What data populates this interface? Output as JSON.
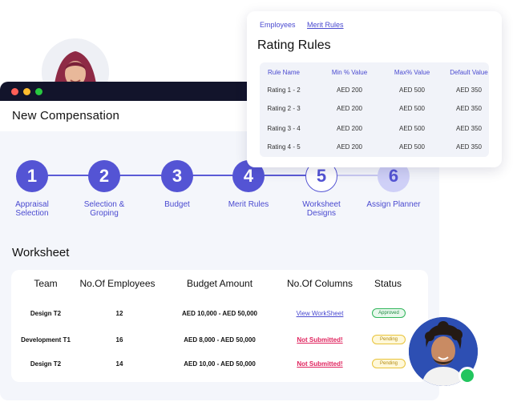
{
  "window": {
    "title": "New Compensation"
  },
  "stepper": {
    "steps": [
      {
        "number": "1",
        "label_line1": "Appraisal",
        "label_line2": "Selection",
        "state": "done"
      },
      {
        "number": "2",
        "label_line1": "Selection &",
        "label_line2": "Groping",
        "state": "done"
      },
      {
        "number": "3",
        "label_line1": "Budget",
        "label_line2": "",
        "state": "done"
      },
      {
        "number": "4",
        "label_line1": "Merit Rules",
        "label_line2": "",
        "state": "done"
      },
      {
        "number": "5",
        "label_line1": "Worksheet",
        "label_line2": "Designs",
        "state": "current"
      },
      {
        "number": "6",
        "label_line1": "Assign Planner",
        "label_line2": "",
        "state": "upcoming"
      }
    ]
  },
  "worksheet": {
    "title": "Worksheet",
    "headers": [
      "Team",
      "No.Of Employees",
      "Budget Amount",
      "No.Of Columns",
      "Status"
    ],
    "rows": [
      {
        "team": "Design T2",
        "employees": "12",
        "budget": "AED 10,000 - AED 50,000",
        "columns": "View WorkSheet",
        "status": "Approved"
      },
      {
        "team": "Development T1",
        "employees": "16",
        "budget": "AED 8,000 - AED 50,000",
        "columns": "Not Submitted!",
        "status": "Pending"
      },
      {
        "team": "Design T2",
        "employees": "14",
        "budget": "AED 10,00 - AED 50,000",
        "columns": "Not Submitted!",
        "status": "Pending"
      }
    ]
  },
  "rating_rules": {
    "tabs": [
      "Employees",
      "Merit Rules"
    ],
    "active_tab": "Merit Rules",
    "title": "Rating Rules",
    "headers": [
      "Rule Name",
      "Min % Value",
      "Max% Value",
      "Default Value"
    ],
    "rows": [
      [
        "Rating 1 - 2",
        "AED 200",
        "AED 500",
        "AED 350"
      ],
      [
        "Rating 2 - 3",
        "AED 200",
        "AED 500",
        "AED 350"
      ],
      [
        "Rating 3 - 4",
        "AED 200",
        "AED 500",
        "AED 350"
      ],
      [
        "Rating 4 - 5",
        "AED 200",
        "AED 500",
        "AED 350"
      ]
    ]
  },
  "colors": {
    "accent": "#5454d4",
    "titlebar": "#12142b",
    "approved": "#2fb55a",
    "pending": "#e8c33a",
    "warning_text": "#e0245e",
    "online": "#22c55e"
  },
  "icons": [
    "avatar-woman",
    "avatar-man",
    "online-status-dot",
    "window-close-dot",
    "window-minimize-dot",
    "window-maximize-dot"
  ]
}
